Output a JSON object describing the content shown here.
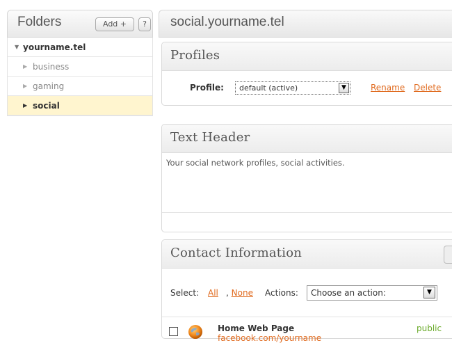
{
  "sidebar": {
    "title": "Folders",
    "add_label": "Add +",
    "help_label": "?",
    "root": "yourname.tel",
    "children": [
      {
        "label": "business"
      },
      {
        "label": "gaming"
      },
      {
        "label": "social"
      }
    ]
  },
  "main": {
    "title": "social.yourname.tel",
    "profiles": {
      "title": "Profiles",
      "profile_label": "Profile:",
      "selected_profile": "default (active)",
      "rename_label": "Rename",
      "delete_label": "Delete"
    },
    "text_header": {
      "title": "Text Header",
      "body": "Your social network profiles, social activities."
    },
    "contact": {
      "title": "Contact Information",
      "select_label": "Select:",
      "all_label": "All",
      "none_label": ", None",
      "none_link": "None",
      "actions_label": "Actions:",
      "action_placeholder": "Choose an action:",
      "item": {
        "title": "Home Web Page",
        "url": "facebook.com/yourname",
        "visibility": "public"
      }
    }
  },
  "colors": {
    "link": "#e06a1e",
    "public": "#6aaa2a",
    "selected_row": "#fff5cf"
  }
}
